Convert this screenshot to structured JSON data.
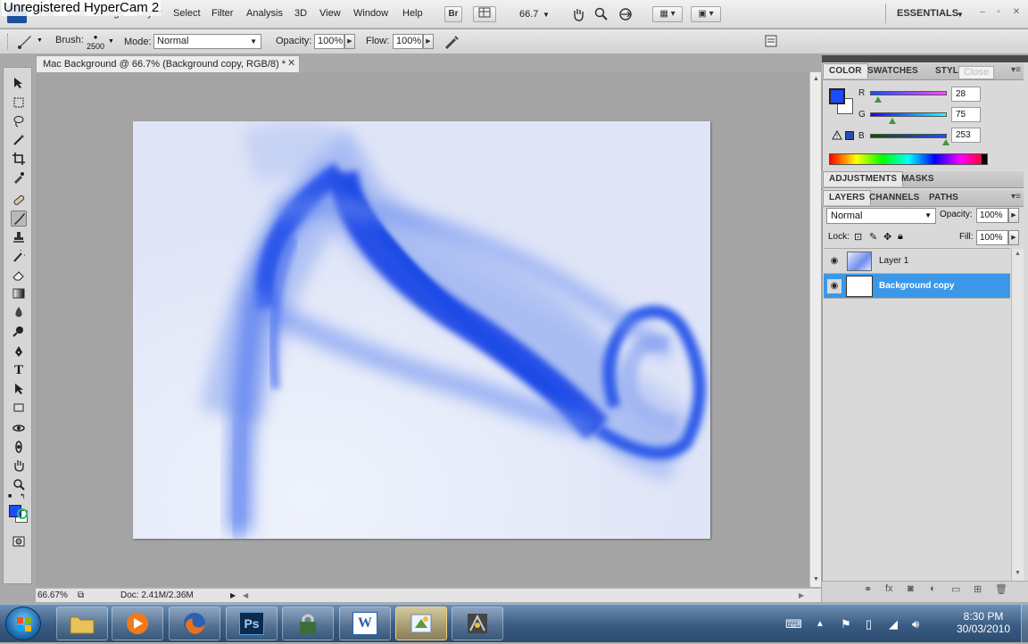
{
  "watermark": "Unregistered HyperCam 2",
  "menubar": {
    "items": [
      "File",
      "Edit",
      "Image",
      "Layer",
      "Select",
      "Filter",
      "Analysis",
      "3D",
      "View",
      "Window",
      "Help"
    ],
    "bridge_label": "Br",
    "zoom_value": "66.7",
    "workspace": "ESSENTIALS",
    "window_controls": [
      "–",
      "▫",
      "✕"
    ]
  },
  "options": {
    "brush_label": "Brush:",
    "brush_size": "2500",
    "mode_label": "Mode:",
    "mode_value": "Normal",
    "opacity_label": "Opacity:",
    "opacity_value": "100%",
    "flow_label": "Flow:",
    "flow_value": "100%"
  },
  "document": {
    "tab_title": "Mac Background @ 66.7% (Background copy, RGB/8) *",
    "close_glyph": "✕",
    "status_zoom": "66.67%",
    "status_doc": "Doc: 2.41M/2.36M"
  },
  "color_panel": {
    "tabs": [
      "COLOR",
      "SWATCHES",
      "STYLES"
    ],
    "tooltip": "Close",
    "fg_color": "#1c4bfd",
    "channels": [
      {
        "label": "R",
        "value": "28"
      },
      {
        "label": "G",
        "value": "75"
      },
      {
        "label": "B",
        "value": "253"
      }
    ]
  },
  "adjustments_panel": {
    "tabs": [
      "ADJUSTMENTS",
      "MASKS"
    ]
  },
  "layers_panel": {
    "tabs": [
      "LAYERS",
      "CHANNELS",
      "PATHS"
    ],
    "blend_mode": "Normal",
    "opacity_label": "Opacity:",
    "opacity_value": "100%",
    "lock_label": "Lock:",
    "fill_label": "Fill:",
    "fill_value": "100%",
    "layers": [
      {
        "name": "Layer 1",
        "selected": false
      },
      {
        "name": "Background copy",
        "selected": true
      }
    ]
  },
  "taskbar": {
    "apps": [
      "explorer",
      "media-player",
      "firefox",
      "photoshop",
      "security",
      "word",
      "paint",
      "game"
    ],
    "ps_label": "Ps",
    "word_label": "W",
    "time": "8:30 PM",
    "date": "30/03/2010"
  },
  "colors": {
    "accent_blue": "#3b8fe6",
    "layer_selected": "#3b98e8",
    "canvas_blue": "#2a55e8"
  }
}
